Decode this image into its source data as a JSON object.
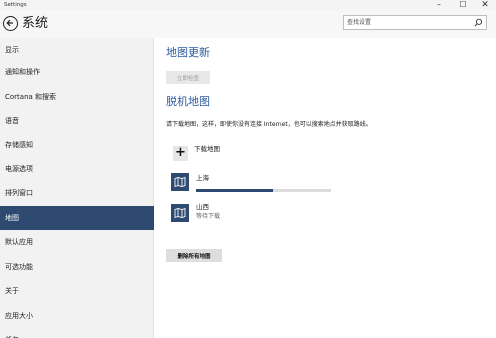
{
  "window": {
    "title": "Settings",
    "controls": {
      "minimize": "–",
      "maximize": "☐",
      "close": "✕"
    }
  },
  "header": {
    "back_icon": "back-arrow-icon",
    "title": "系统",
    "search_placeholder": "查找设置",
    "search_icon": "search-icon"
  },
  "sidebar": {
    "items": [
      {
        "label": "显示"
      },
      {
        "label": "通知和操作"
      },
      {
        "label": "Cortana 和搜索"
      },
      {
        "label": "语音"
      },
      {
        "label": "存储感知"
      },
      {
        "label": "电源选项"
      },
      {
        "label": "排列窗口"
      },
      {
        "label": "地图",
        "active": true
      },
      {
        "label": "默认应用"
      },
      {
        "label": "可选功能"
      },
      {
        "label": "关于"
      },
      {
        "label": "应用大小"
      },
      {
        "label": "任务"
      }
    ],
    "active_color": "#2e4a70"
  },
  "main": {
    "map_update": {
      "heading": "地图更新",
      "check_button": "立即检查"
    },
    "offline_maps": {
      "heading": "脱机地图",
      "description": "请下载地图，这样，即使你没有连接 Internet，也可以搜索地点并获取路线。",
      "download_label": "下载地图",
      "maps": [
        {
          "name": "上海",
          "progress": 0.57,
          "status": ""
        },
        {
          "name": "山西",
          "status": "等待下载"
        }
      ],
      "delete_button": "删除所有地图"
    },
    "accent_color": "#2d5a9e"
  }
}
